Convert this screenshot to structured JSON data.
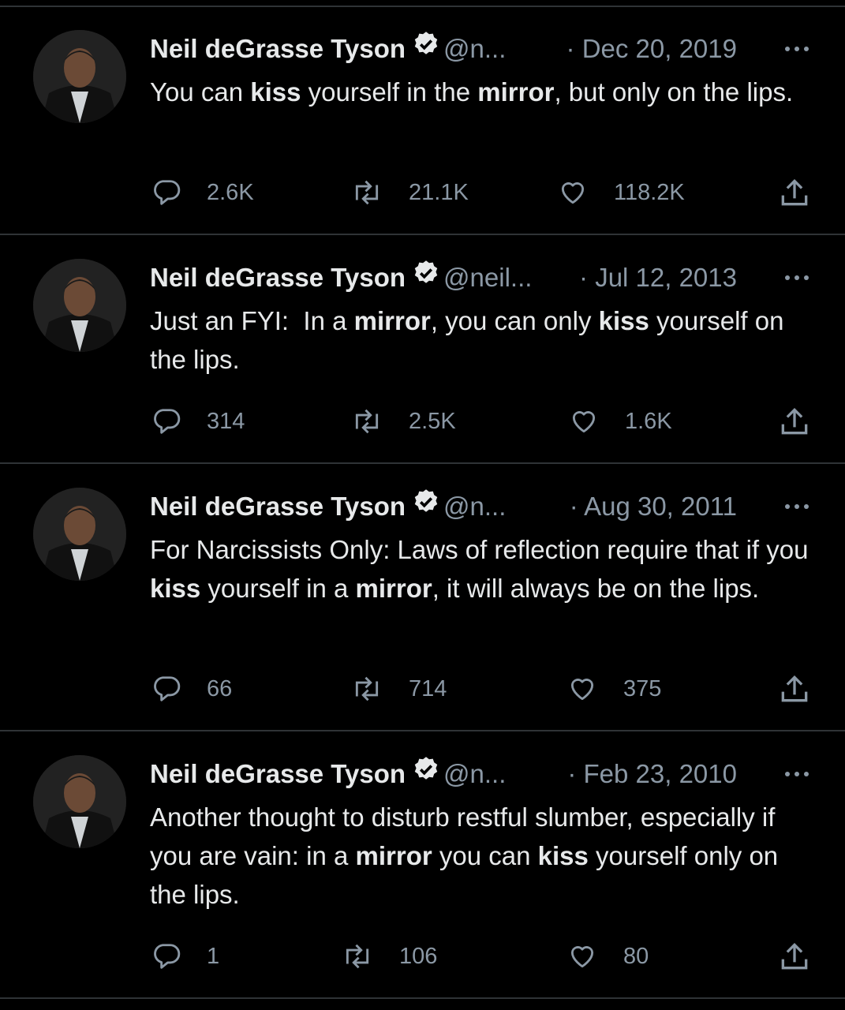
{
  "colors": {
    "background": "#000000",
    "text": "#e7e9ea",
    "muted": "#8b98a5",
    "divider": "#2f3336"
  },
  "tweets": [
    {
      "author": "Neil deGrasse Tyson",
      "handle": "@n...",
      "sep": "·",
      "date": "Dec 20, 2019",
      "body": "You can <b>kiss</b> yourself in the <b>mirror</b>, but only on the lips.",
      "replies": "2.6K",
      "retweets": "21.1K",
      "likes": "118.2K"
    },
    {
      "author": "Neil deGrasse Tyson",
      "handle": "@neil...",
      "sep": "·",
      "date": "Jul 12, 2013",
      "body": "Just an FYI:&nbsp; In a <b>mirror</b>, you can only <b>kiss</b> yourself on the lips.",
      "replies": "314",
      "retweets": "2.5K",
      "likes": "1.6K"
    },
    {
      "author": "Neil deGrasse Tyson",
      "handle": "@n...",
      "sep": "·",
      "date": "Aug 30, 2011",
      "body": "For Narcissists Only: Laws of reflection require that if you <b>kiss</b> yourself in a <b>mirror</b>, it will always be on the lips.",
      "replies": "66",
      "retweets": "714",
      "likes": "375"
    },
    {
      "author": "Neil deGrasse Tyson",
      "handle": "@n...",
      "sep": "·",
      "date": "Feb 23, 2010",
      "body": "Another thought to disturb restful slumber, especially if you are vain: in a <b>mirror</b> you can <b>kiss</b> yourself only on the lips.",
      "replies": "1",
      "retweets": "106",
      "likes": "80"
    }
  ]
}
